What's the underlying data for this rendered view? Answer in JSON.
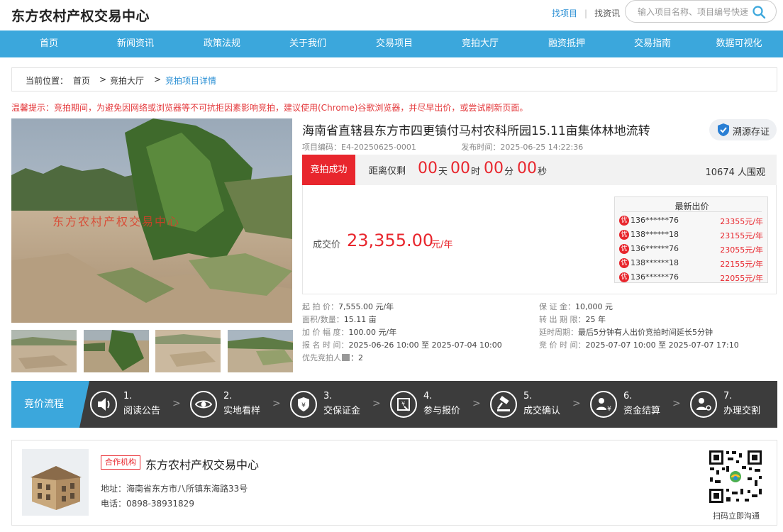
{
  "site": {
    "title": "东方农村产权交易中心"
  },
  "top_links": {
    "find_project": "找项目",
    "find_news": "找资讯"
  },
  "search": {
    "placeholder": "输入项目名称、项目编号快速"
  },
  "nav": [
    "首页",
    "新闻资讯",
    "政策法规",
    "关于我们",
    "交易项目",
    "竞拍大厅",
    "融资抵押",
    "交易指南",
    "数据可视化"
  ],
  "breadcrumb": {
    "prefix": "当前位置：",
    "home": "首页",
    "sep": ">",
    "hall": "竞拍大厅",
    "current": "竞拍项目详情"
  },
  "tip": "温馨提示：竞拍期间，为避免因网络或浏览器等不可抗拒因素影响竞拍，建议使用(Chrome)谷歌浏览器，并尽早出价，或尝试刷新页面。",
  "image_watermark": "东方农村产权交易中心",
  "project": {
    "title": "海南省直辖县东方市四更镇付马村农科所园15.11亩集体林地流转",
    "trace_label": "溯源存证",
    "code": "项目编码：E4-20250625-0001",
    "publish": "发布时间：2025-06-25 14:22:36"
  },
  "status": {
    "badge": "竞拍成功",
    "remain_label": "距离仅剩",
    "days": "00",
    "days_unit": "天",
    "hours": "00",
    "hours_unit": "时",
    "minutes": "00",
    "minutes_unit": "分",
    "seconds": "00",
    "seconds_unit": "秒",
    "viewers": "10674 人围观"
  },
  "deal": {
    "label": "成交价",
    "value": "23,355.00",
    "unit": "元/年"
  },
  "latest_bids": {
    "title": "最新出价",
    "tag": "优",
    "rows": [
      {
        "name": "136******76",
        "price": "23355元/年"
      },
      {
        "name": "138******18",
        "price": "23155元/年"
      },
      {
        "name": "136******76",
        "price": "23055元/年"
      },
      {
        "name": "138******18",
        "price": "22155元/年"
      },
      {
        "name": "136******76",
        "price": "22055元/年"
      }
    ]
  },
  "info": {
    "start_price_k": "起  拍  价：",
    "start_price_v": "7,555.00 元/年",
    "deposit_k": "保  证  金：",
    "deposit_v": "10,000 元",
    "area_k": "面积/数量：",
    "area_v": "15.11 亩",
    "term_k": "转 出 期 限：",
    "term_v": "25 年",
    "increment_k": "加 价 幅 度：",
    "increment_v": "100.00 元/年",
    "delay_k": "延时周期：",
    "delay_v": "最后5分钟有人出价竞拍时间延长5分钟",
    "signup_k": "报 名 时 间：",
    "signup_v": "2025-06-26 10:00 至 2025-07-04 10:00",
    "bidtime_k": "竞 价 时 间：",
    "bidtime_v": "2025-07-07 10:00 至 2025-07-07 17:10",
    "priority_k": "优先竞拍人",
    "priority_v": "：2"
  },
  "flow": {
    "tag": "竞价流程",
    "steps": [
      {
        "num": "1.",
        "label": "阅读公告"
      },
      {
        "num": "2.",
        "label": "实地看样"
      },
      {
        "num": "3.",
        "label": "交保证金"
      },
      {
        "num": "4.",
        "label": "参与报价"
      },
      {
        "num": "5.",
        "label": "成交确认"
      },
      {
        "num": "6.",
        "label": "资金结算"
      },
      {
        "num": "7.",
        "label": "办理交割"
      }
    ]
  },
  "org": {
    "tag": "合作机构",
    "name": "东方农村产权交易中心",
    "address": "地址：海南省东方市八所镇东海路33号",
    "phone": "电话：0898-38931829",
    "qr_caption": "扫码立即沟通"
  },
  "colors": {
    "accent": "#3ba7dc",
    "red": "#e8262d",
    "flow_bg": "#3c3c3c"
  }
}
